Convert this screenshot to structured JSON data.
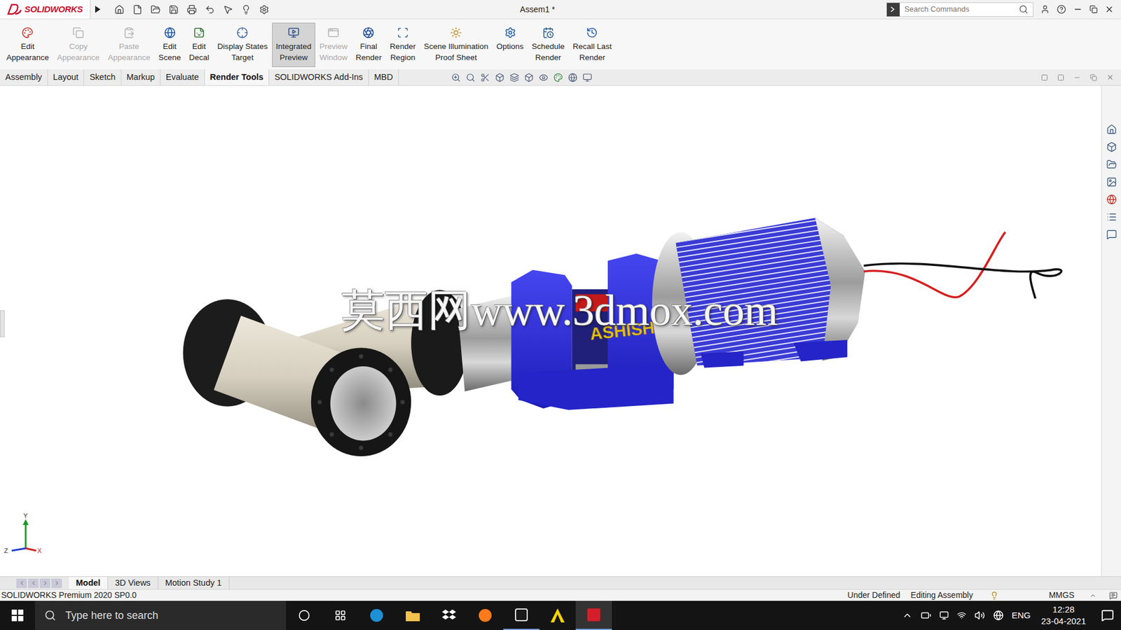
{
  "title_bar": {
    "app": "SOLIDWORKS",
    "document": "Assem1 *",
    "search_placeholder": "Search Commands"
  },
  "ribbon": [
    {
      "lines": [
        "Edit",
        "Appearance"
      ],
      "disabled": false,
      "selected": false
    },
    {
      "lines": [
        "Copy",
        "Appearance"
      ],
      "disabled": true,
      "selected": false
    },
    {
      "lines": [
        "Paste",
        "Appearance"
      ],
      "disabled": true,
      "selected": false
    },
    {
      "lines": [
        "Edit",
        "Scene"
      ],
      "disabled": false,
      "selected": false
    },
    {
      "lines": [
        "Edit",
        "Decal"
      ],
      "disabled": false,
      "selected": false
    },
    {
      "lines": [
        "Display States",
        "Target"
      ],
      "disabled": false,
      "selected": false
    },
    {
      "lines": [
        "Integrated",
        "Preview"
      ],
      "disabled": false,
      "selected": true
    },
    {
      "lines": [
        "Preview",
        "Window"
      ],
      "disabled": true,
      "selected": false
    },
    {
      "lines": [
        "Final",
        "Render"
      ],
      "disabled": false,
      "selected": false
    },
    {
      "lines": [
        "Render",
        "Region"
      ],
      "disabled": false,
      "selected": false
    },
    {
      "lines": [
        "Scene Illumination",
        "Proof Sheet"
      ],
      "disabled": false,
      "selected": false
    },
    {
      "lines": [
        "Options"
      ],
      "disabled": false,
      "selected": false
    },
    {
      "lines": [
        "Schedule",
        "Render"
      ],
      "disabled": false,
      "selected": false
    },
    {
      "lines": [
        "Recall Last",
        "Render"
      ],
      "disabled": false,
      "selected": false
    }
  ],
  "command_tabs": [
    {
      "label": "Assembly",
      "selected": false
    },
    {
      "label": "Layout",
      "selected": false
    },
    {
      "label": "Sketch",
      "selected": false
    },
    {
      "label": "Markup",
      "selected": false
    },
    {
      "label": "Evaluate",
      "selected": false
    },
    {
      "label": "Render Tools",
      "selected": true
    },
    {
      "label": "SOLIDWORKS Add-Ins",
      "selected": false
    },
    {
      "label": "MBD",
      "selected": false
    }
  ],
  "viewport": {
    "watermark": "莫西网www.3dmox.com",
    "decal": "ASHISH",
    "triad": {
      "x": "X",
      "y": "Y",
      "z": "Z"
    }
  },
  "bottom_tabs": [
    {
      "label": "Model",
      "selected": true
    },
    {
      "label": "3D Views",
      "selected": false
    },
    {
      "label": "Motion Study 1",
      "selected": false
    }
  ],
  "status_bar": {
    "product": "SOLIDWORKS Premium 2020 SP0.0",
    "state": "Under Defined",
    "mode": "Editing Assembly",
    "units": "MMGS"
  },
  "taskbar": {
    "search_placeholder": "Type here to search",
    "language": "ENG",
    "time": "12:28",
    "date": "23-04-2021"
  }
}
